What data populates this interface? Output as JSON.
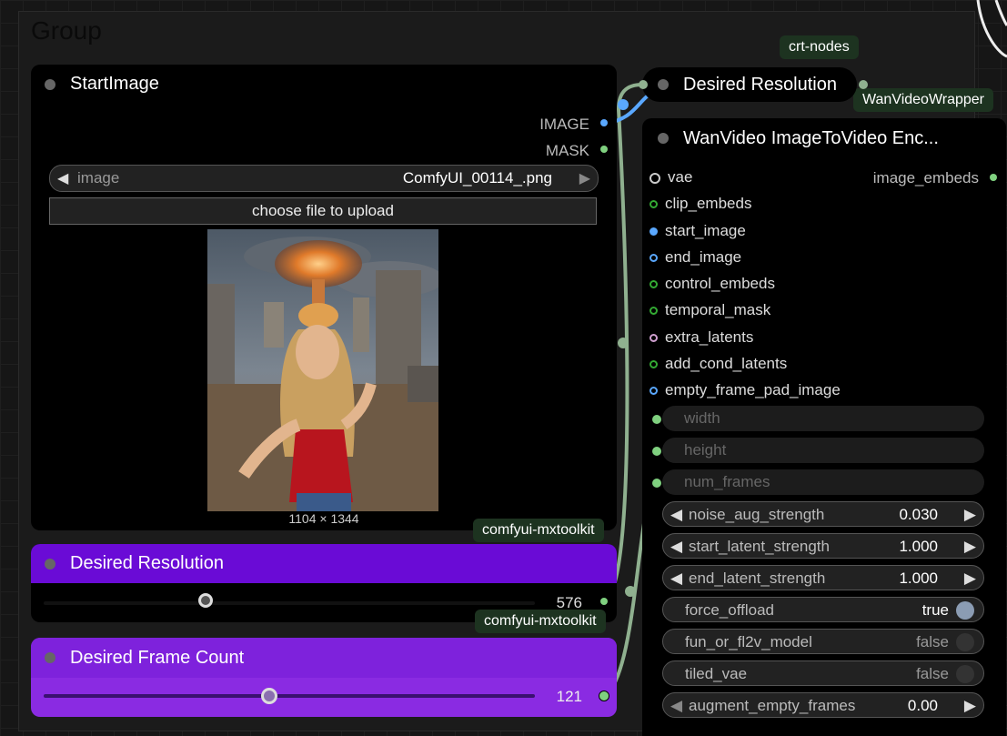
{
  "group": {
    "title": "Group"
  },
  "start_image": {
    "title": "StartImage",
    "outputs": [
      "IMAGE",
      "MASK"
    ],
    "image_combo": {
      "label": "image",
      "value": "ComfyUI_00114_.png"
    },
    "upload_button": "choose file to upload",
    "image_size": "1104 × 1344"
  },
  "badges": {
    "crt": "crt-nodes",
    "wanvideo": "WanVideoWrapper",
    "mxtoolkit_1": "comfyui-mxtoolkit",
    "mxtoolkit_2": "comfyui-mxtoolkit"
  },
  "desired_resolution_collapsed": {
    "title": "Desired Resolution"
  },
  "desired_resolution": {
    "title": "Desired Resolution",
    "value": "576",
    "slider_fraction": 0.33
  },
  "desired_frame_count": {
    "title": "Desired Frame Count",
    "value": "121",
    "slider_fraction": 0.46
  },
  "wanvideo": {
    "title": "WanVideo ImageToVideo Enc...",
    "output": "image_embeds",
    "inputs": [
      "vae",
      "clip_embeds",
      "start_image",
      "end_image",
      "control_embeds",
      "temporal_mask",
      "extra_latents",
      "add_cond_latents",
      "empty_frame_pad_image"
    ],
    "linked_widgets": [
      "width",
      "height",
      "num_frames"
    ],
    "widgets": [
      {
        "label": "noise_aug_strength",
        "value": "0.030"
      },
      {
        "label": "start_latent_strength",
        "value": "1.000"
      },
      {
        "label": "end_latent_strength",
        "value": "1.000"
      }
    ],
    "toggles": [
      {
        "label": "force_offload",
        "value": "true"
      },
      {
        "label": "fun_or_fl2v_model",
        "value": "false"
      },
      {
        "label": "tiled_vae",
        "value": "false"
      }
    ],
    "augment": {
      "label": "augment_empty_frames",
      "value": "0.00"
    }
  },
  "arrows": {
    "left": "◀",
    "right": "▶"
  },
  "colors": {
    "accent_purple": "#6a0bd6",
    "accent_purple_light": "#8a2be2",
    "link_green": "#8fb08f",
    "image_blue": "#5aa8ff"
  }
}
